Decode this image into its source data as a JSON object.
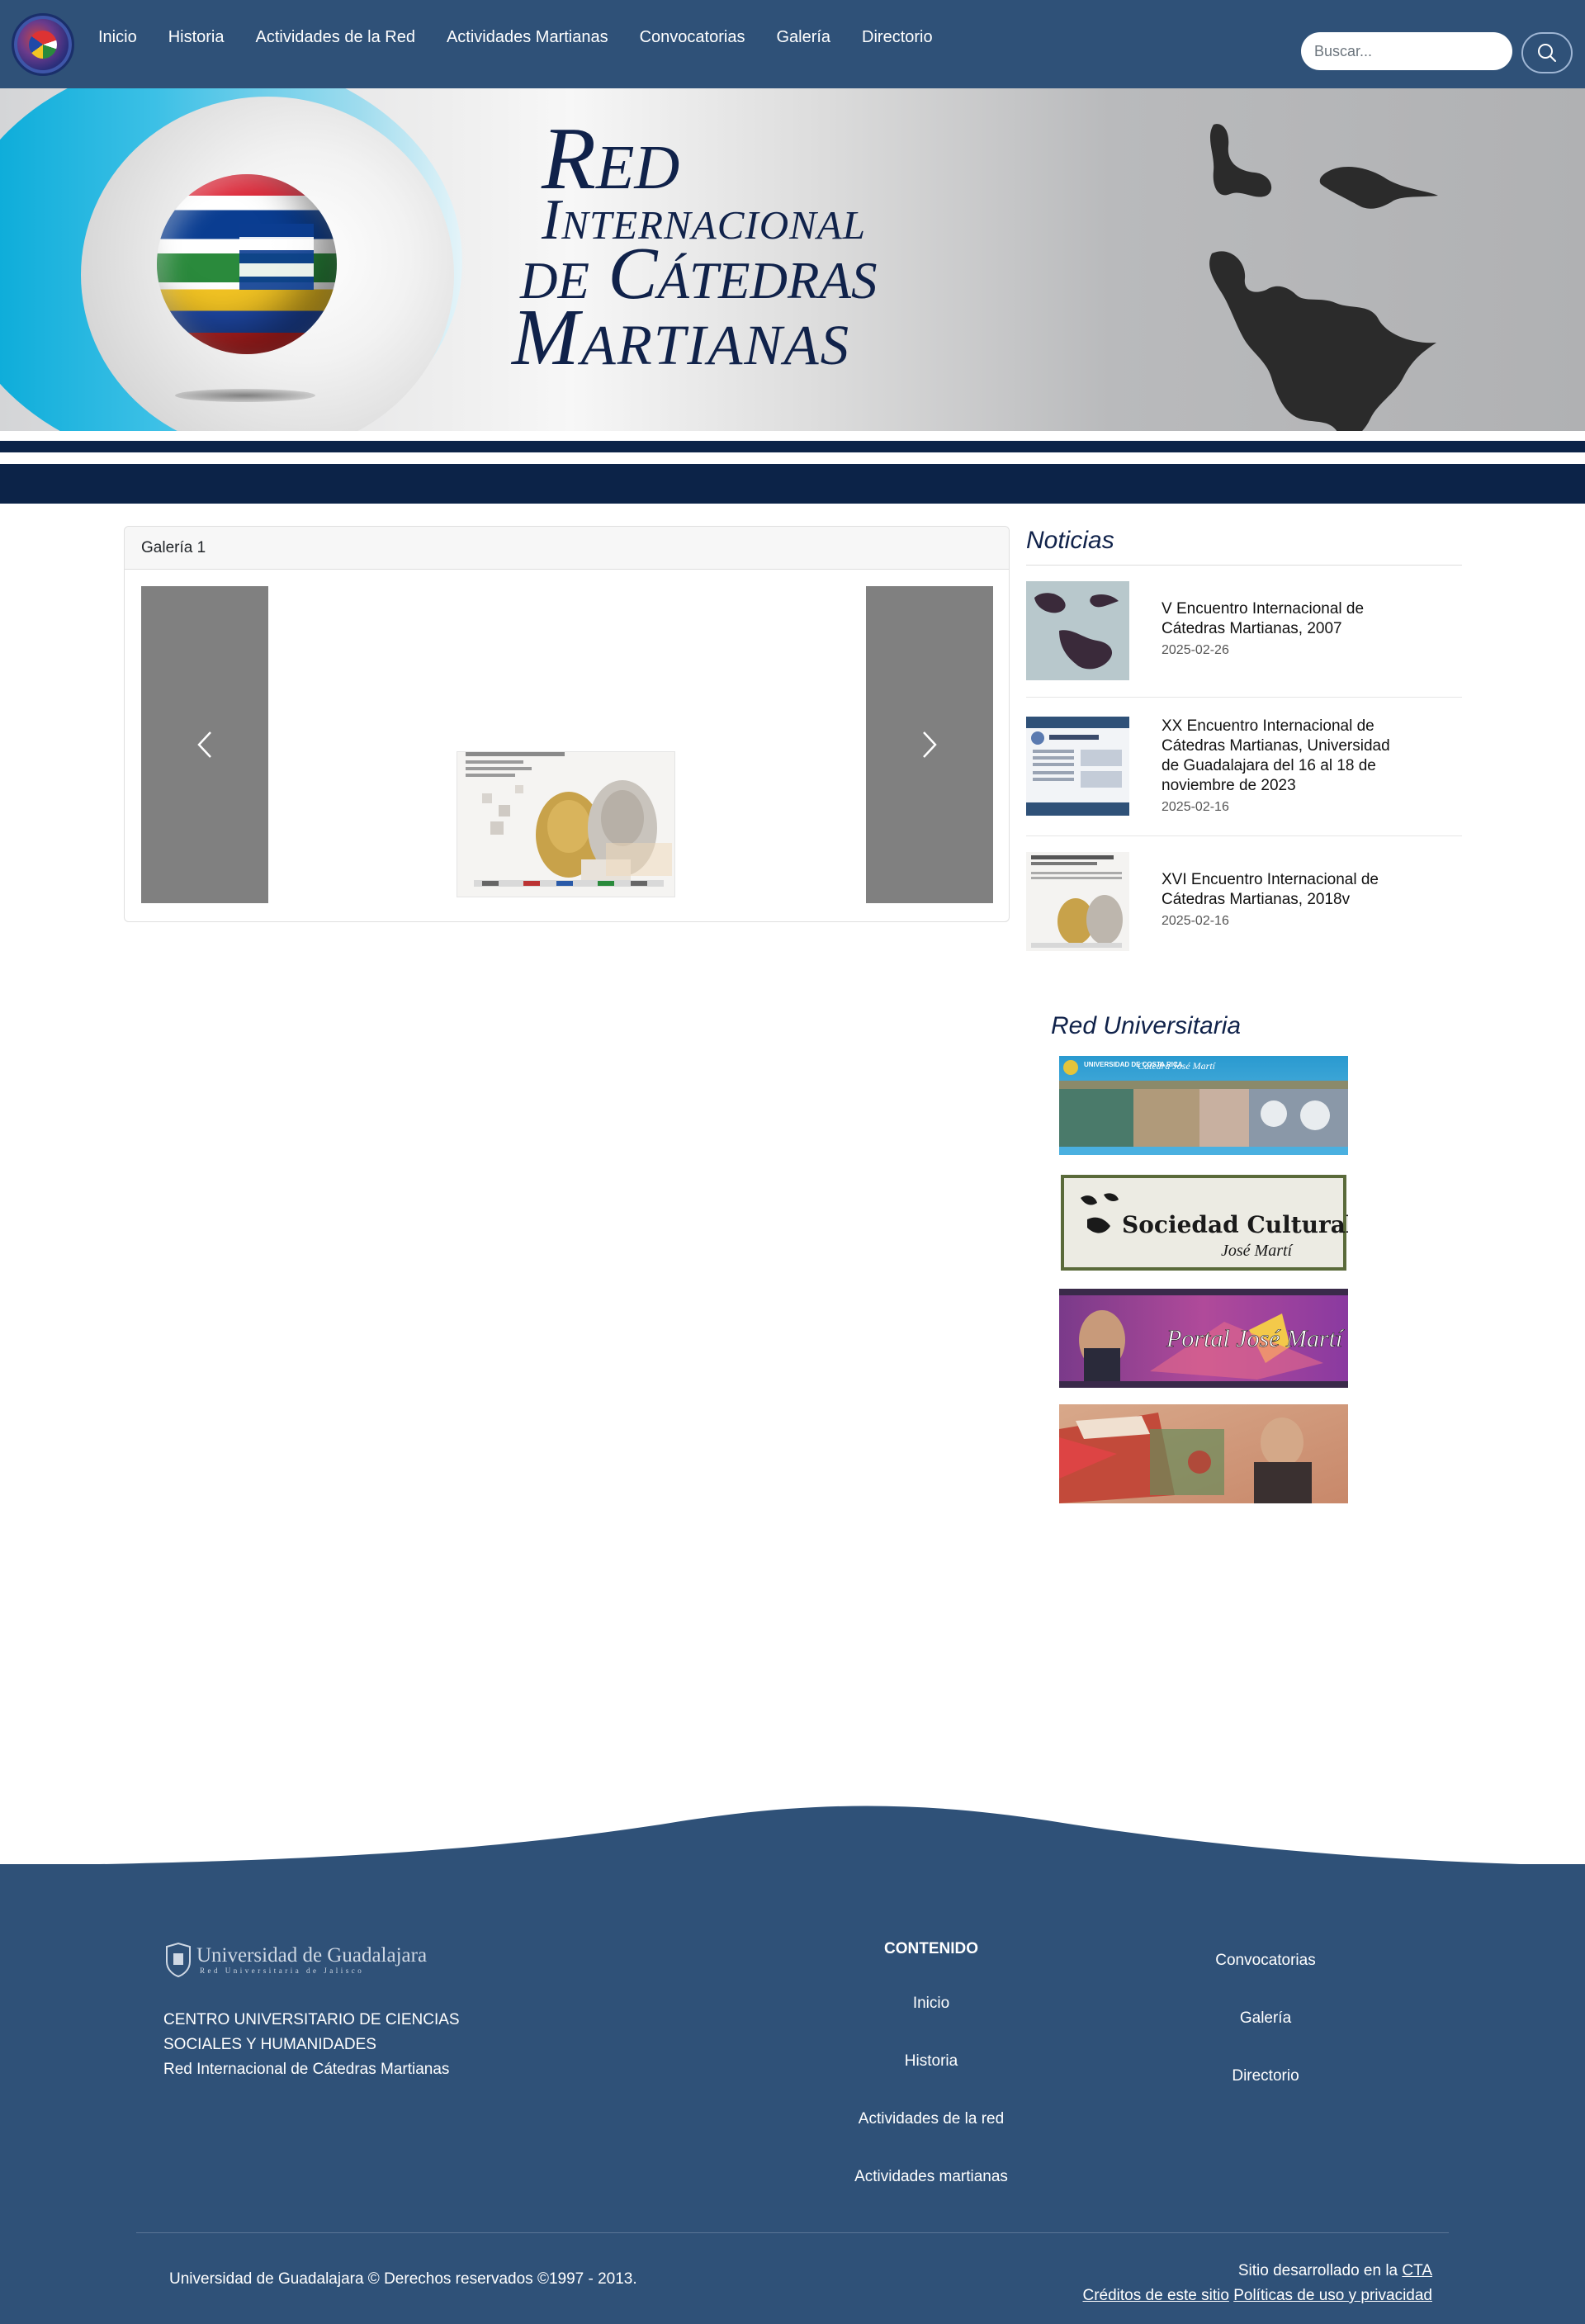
{
  "nav": {
    "links": [
      "Inicio",
      "Historia",
      "Actividades de la Red",
      "Actividades Martianas",
      "Convocatorias",
      "Galería",
      "Directorio"
    ],
    "search_placeholder": "Buscar..."
  },
  "banner": {
    "title_line1": "Red",
    "title_line2": "Internacional",
    "title_line3": "de Cátedras",
    "title_line4": "Martianas"
  },
  "gallery": {
    "heading": "Galería 1"
  },
  "news": {
    "heading": "Noticias",
    "items": [
      {
        "title": "V Encuentro Internacional de Cátedras Martianas, 2007",
        "date": "2025-02-26"
      },
      {
        "title": "XX Encuentro Internacional de Cátedras Martianas, Universidad de Guadalajara del 16 al 18 de noviembre de 2023",
        "date": "2025-02-16"
      },
      {
        "title": "XVI Encuentro Internacional de Cátedras Martianas, 2018v",
        "date": "2025-02-16"
      }
    ]
  },
  "red_universitaria": {
    "heading": "Red Universitaria",
    "logo1_text": "UNIVERSIDAD DE COSTA RICA",
    "logo1_sub": "Cátedra José Martí",
    "logo2_text": "Sociedad Cultural",
    "logo2_sub": "José Martí",
    "logo3_text": "Portal José Martí"
  },
  "footer": {
    "udg_logo_text": "Universidad de Guadalajara",
    "udg_logo_sub": "Red Universitaria de Jalisco",
    "address_line1": "CENTRO UNIVERSITARIO DE CIENCIAS",
    "address_line2": "SOCIALES Y HUMANIDADES",
    "address_line3": "Red Internacional de Cátedras Martianas",
    "content_heading": "CONTENIDO",
    "col1": [
      "Inicio",
      "Historia",
      "Actividades de la red",
      "Actividades martianas"
    ],
    "col2": [
      "Convocatorias",
      "Galería",
      "Directorio"
    ],
    "copyright": "Universidad de Guadalajara © Derechos reservados ©1997 - 2013.",
    "dev_prefix": "Sitio desarrollado en la",
    "dev_link": "CTA",
    "credits_link": "Créditos de este sitio",
    "privacy_link": "Políticas de uso y privacidad"
  },
  "colors": {
    "navbar": "#2f5178",
    "banner_stripe": "#0c2348",
    "heading": "#10224a",
    "carousel_control": "#808080"
  }
}
